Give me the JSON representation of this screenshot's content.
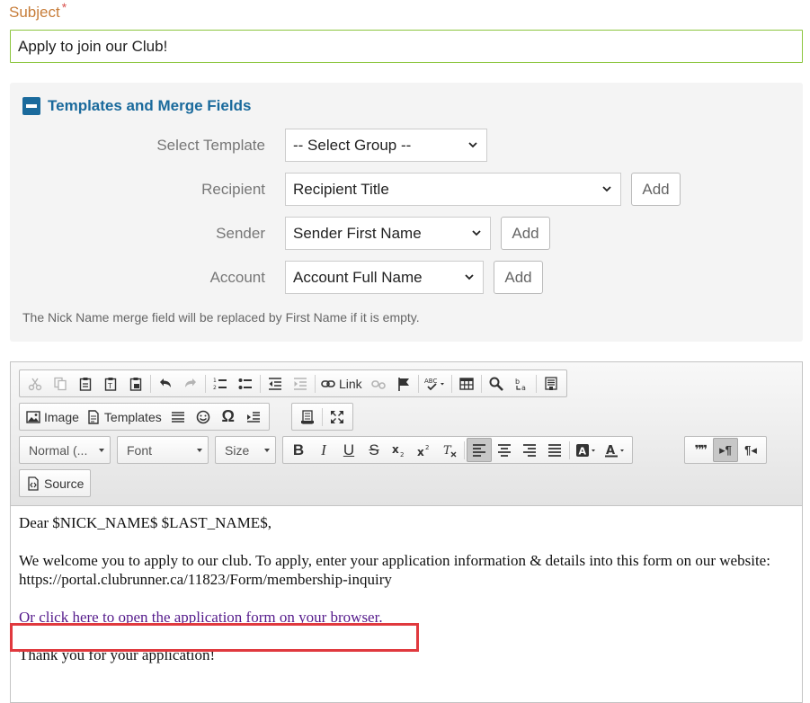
{
  "subject": {
    "label": "Subject",
    "required_mark": "*",
    "value": "Apply to join our Club!"
  },
  "templates": {
    "title": "Templates and Merge Fields",
    "rows": [
      {
        "label": "Select Template",
        "selected": "-- Select Group --",
        "add": ""
      },
      {
        "label": "Recipient",
        "selected": "Recipient Title",
        "add": "Add"
      },
      {
        "label": "Sender",
        "selected": "Sender First Name",
        "add": "Add"
      },
      {
        "label": "Account",
        "selected": "Account Full Name",
        "add": "Add"
      }
    ],
    "note": "The Nick Name merge field will be replaced by First Name if it is empty."
  },
  "toolbar": {
    "link_label": "Link",
    "image_label": "Image",
    "templates_label": "Templates",
    "format_combo": "Normal (...",
    "font_combo": "Font",
    "size_combo": "Size",
    "source_label": "Source",
    "bold": "B",
    "italic": "I",
    "underline": "U",
    "strike": "S",
    "omega": "Ω",
    "quote": "❞❞",
    "ltr": "▸¶",
    "rtl": "¶◂"
  },
  "body": {
    "greeting": "Dear $NICK_NAME$ $LAST_NAME$,",
    "para1": "We welcome you to apply to our club. To apply, enter your application information & details into this form on our website:",
    "url": "https://portal.clubrunner.ca/11823/Form/membership-inquiry",
    "link_text": "Or click here to open the application form on your browser.",
    "thanks": "Thank you for your application!"
  },
  "colors": {
    "accent": "#1a6a9c",
    "subject_label": "#c77d3a",
    "input_border": "#8cc63f",
    "highlight": "#e0393e",
    "link": "#551a8b"
  }
}
